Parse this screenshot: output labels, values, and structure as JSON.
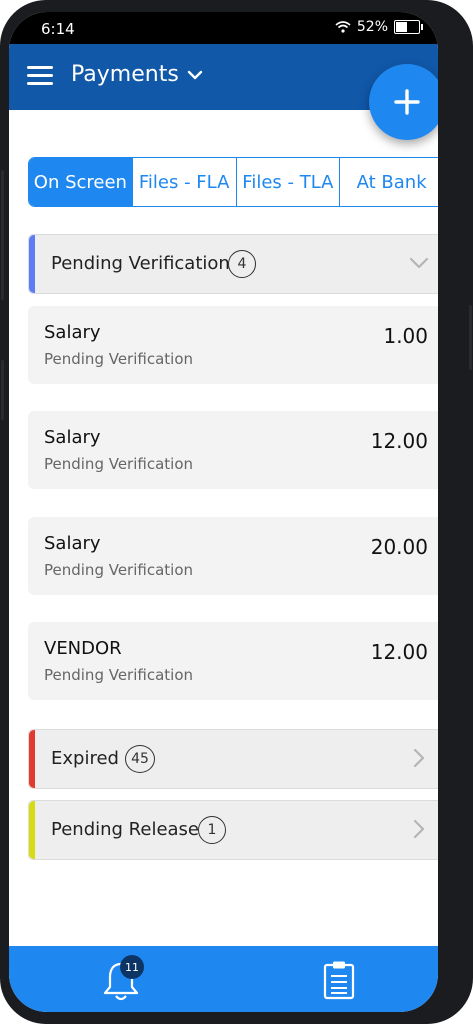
{
  "status_bar": {
    "time": "6:14",
    "battery": "52%",
    "battery_level": 0.52
  },
  "app_bar": {
    "title": "Payments"
  },
  "tabs": [
    {
      "label": "On Screen",
      "active": true
    },
    {
      "label": "Files - FLA",
      "active": false
    },
    {
      "label": "Files - TLA",
      "active": false
    },
    {
      "label": "At Bank",
      "active": false
    }
  ],
  "sections": {
    "pending_verification": {
      "label": "Pending Verification",
      "count": "4",
      "accent": "#5b7cf5",
      "expanded": true
    },
    "expired": {
      "label": "Expired",
      "count": "45",
      "accent": "#e23a2e",
      "expanded": false
    },
    "pending_release": {
      "label": "Pending Release",
      "count": "1",
      "accent": "#d6dc14",
      "expanded": false
    }
  },
  "payments": [
    {
      "name": "Salary",
      "status": "Pending Verification",
      "amount": "1.00"
    },
    {
      "name": "Salary",
      "status": "Pending Verification",
      "amount": "12.00"
    },
    {
      "name": "Salary",
      "status": "Pending Verification",
      "amount": "20.00"
    },
    {
      "name": "VENDOR",
      "status": "Pending Verification",
      "amount": "12.00"
    }
  ],
  "bottom_bar": {
    "notification_count": "11",
    "icons": [
      "bell-icon",
      "clipboard-icon"
    ]
  },
  "colors": {
    "app_bar": "#1158a9",
    "accent_blue": "#1e88f0",
    "fab": "#1e88f0"
  }
}
